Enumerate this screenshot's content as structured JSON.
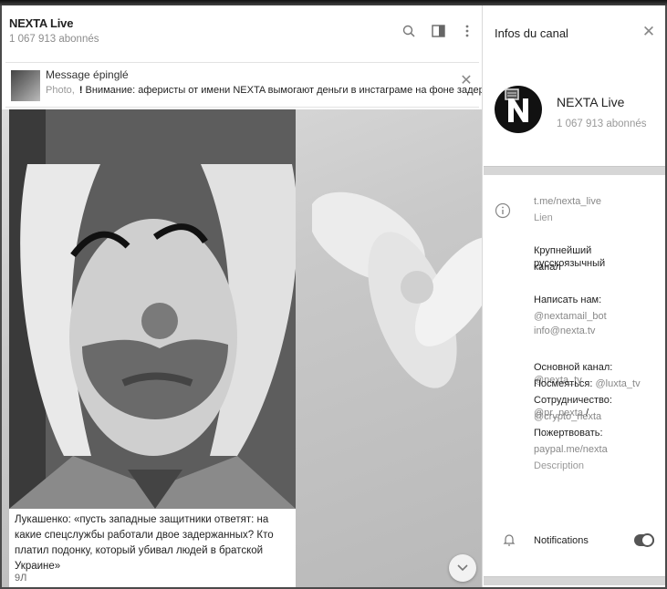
{
  "chat": {
    "title": "NEXTA Live",
    "subscribers": "1 067 913 abonnés",
    "icons": [
      "search-icon",
      "sidebar-toggle-icon",
      "more-vertical-icon"
    ]
  },
  "pinned": {
    "label": "Message épinglé",
    "media_type": "Photo,",
    "alert_mark": "!",
    "preview": "Внимание: аферисты от имени NEXTA вымогают деньги в инстаграме на фоне задер...",
    "close_icon": "close-icon"
  },
  "message": {
    "text": "Лукашенко: «пусть западные защитники ответят: на какие спецслужбы работали двое задержанных? Кто платил подонку, который убивал людей в братской Украине»",
    "views": "9Л"
  },
  "info": {
    "header": "Infos du canal",
    "name": "NEXTA Live",
    "subscribers": "1 067 913 abonnés",
    "link": "t.me/nexta_live",
    "link_caption": "Lien",
    "desc_line1": "Крупнейший русскоязычный",
    "desc_line2": "канал",
    "write_label": "Написать нам:",
    "write_bot": "@nextamail_bot",
    "write_email": "info@nexta.tv",
    "main_label": "Основной канал:",
    "main_value": "@nexta_tv",
    "fun_label": "Посмеяться:",
    "fun_value": "@luxta_tv",
    "coop_label": "Сотрудничество:",
    "coop_value": "@pr_nexta",
    "coop_sep": " /",
    "coop_value2": "@crypto_nexta",
    "donate_label": "Пожертвовать:",
    "donate_value": "paypal.me/nexta",
    "desc_caption": "Description",
    "notifications": "Notifications",
    "notifications_on": true
  },
  "colors": {
    "toggle": "#555555",
    "divider": "#d6d6d6"
  }
}
